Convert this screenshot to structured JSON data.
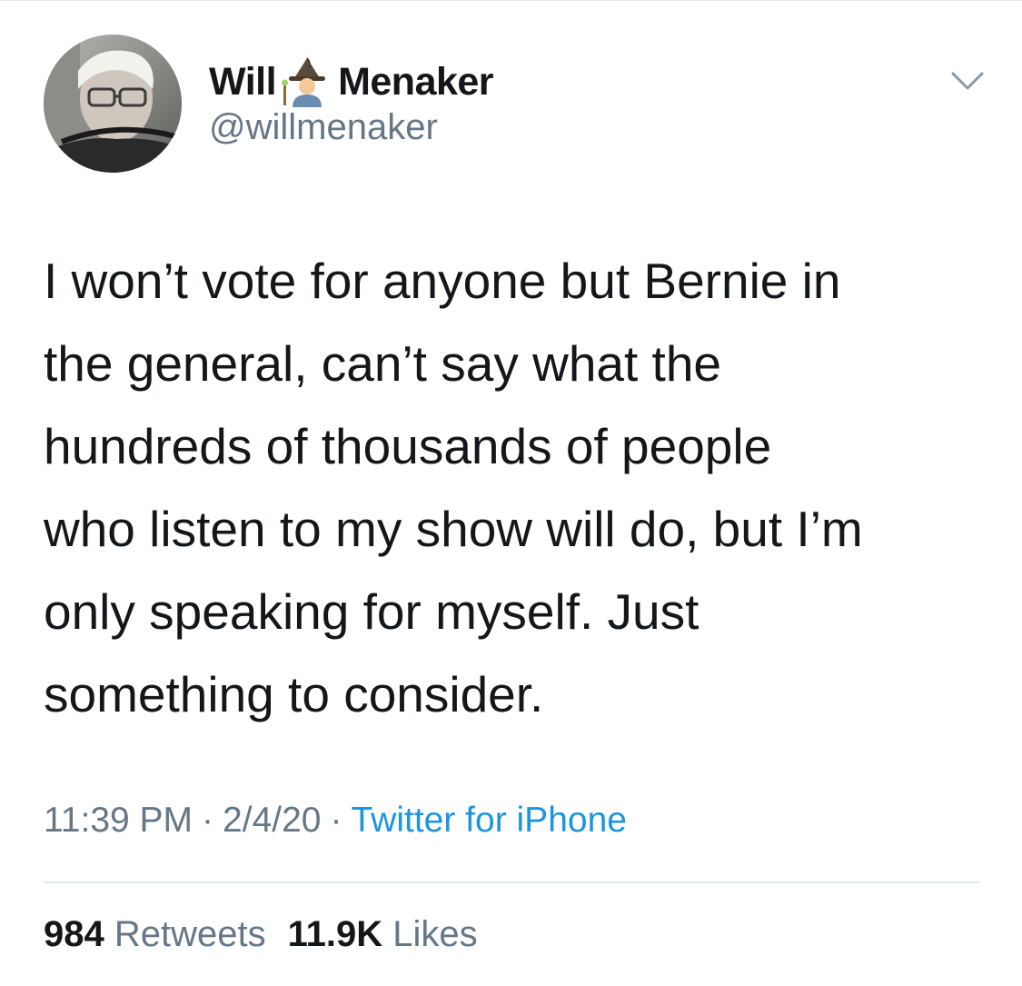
{
  "tweet": {
    "author": {
      "name_first": "Will",
      "name_emoji": "mage-emoji",
      "name_last": "Menaker",
      "handle": "@willmenaker",
      "avatar": "profile-photo"
    },
    "menu_icon": "chevron-down-icon",
    "text_lines": [
      "I won’t vote for anyone but Bernie in",
      "the general, can’t say what the",
      "hundreds of thousands of people",
      "who listen to my show will do, but I’m",
      "only speaking for myself. Just",
      "something to consider."
    ],
    "time": "11:39 PM",
    "date": "2/4/20",
    "separator": "·",
    "source": "Twitter for iPhone",
    "retweets": {
      "count": "984",
      "label": "Retweets"
    },
    "likes": {
      "count": "11.9K",
      "label": "Likes"
    }
  },
  "colors": {
    "text": "#14171a",
    "secondary": "#657786",
    "link": "#1b95e0",
    "divider": "#e1e8ed"
  }
}
